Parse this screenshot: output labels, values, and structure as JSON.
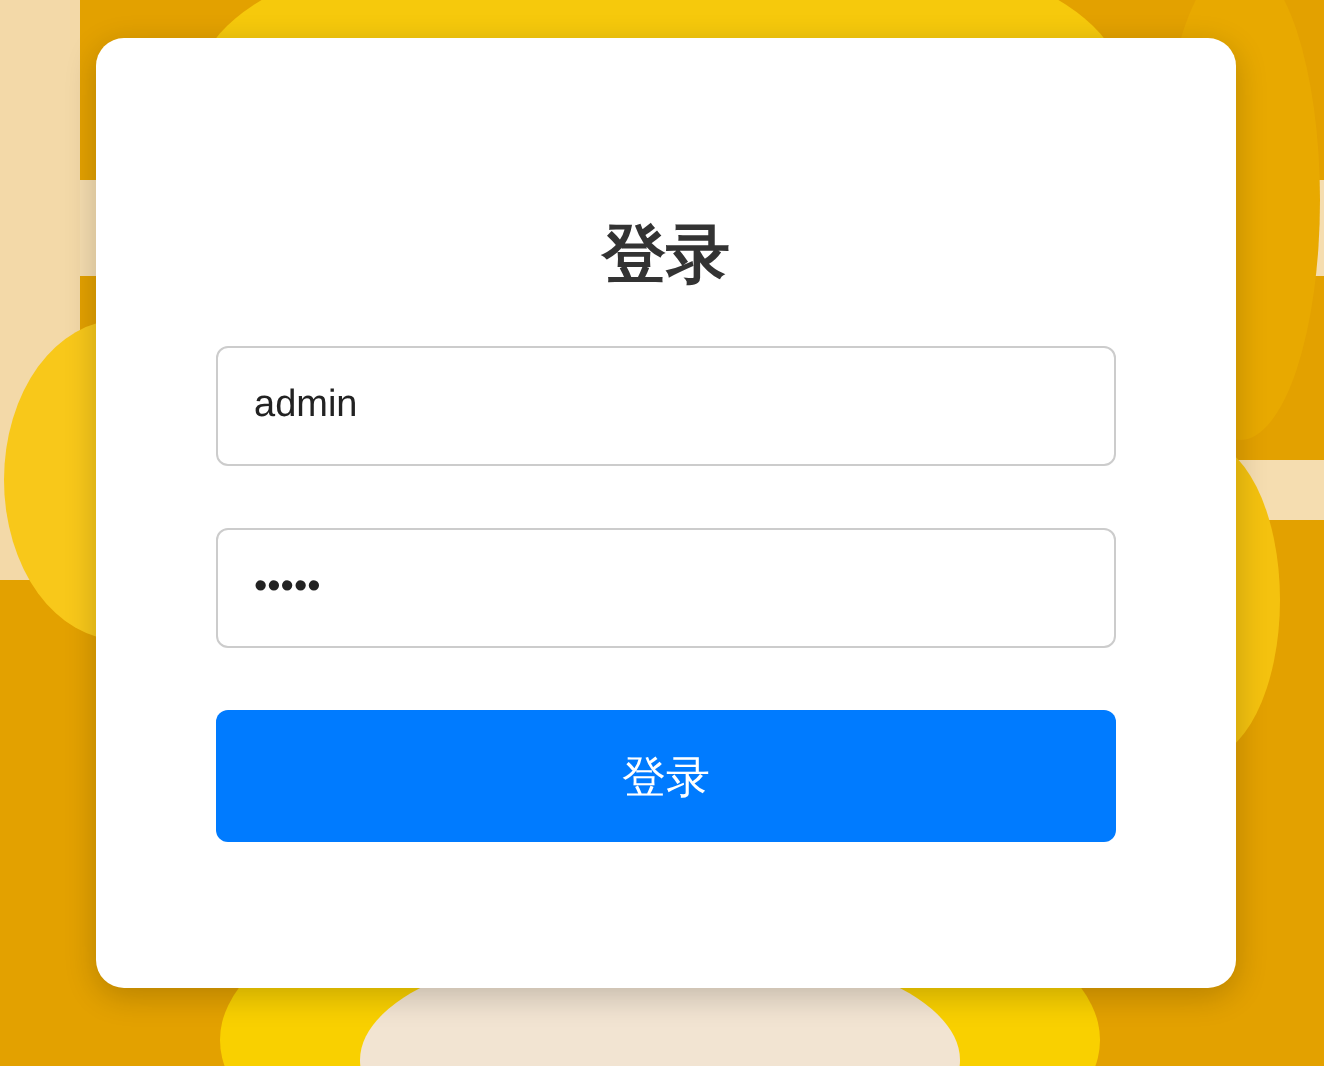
{
  "login": {
    "title": "登录",
    "username": {
      "value": "admin"
    },
    "password": {
      "value": "•••••"
    },
    "submit": "登录"
  }
}
